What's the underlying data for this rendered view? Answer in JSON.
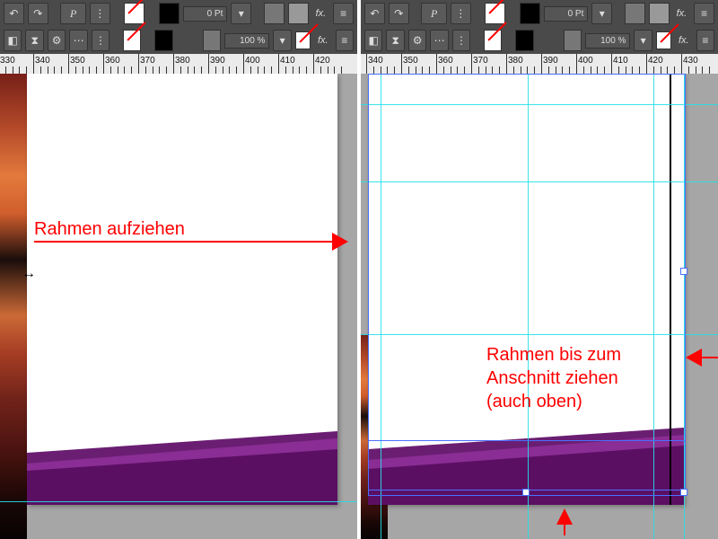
{
  "toolbar": {
    "history_icons": [
      "↶",
      "↷"
    ],
    "quickapply": "⚙",
    "char_style_letter": "P",
    "dotted": "⋯",
    "more": "⋮",
    "stroke_pt": "0 Pt",
    "opacity": "100 %",
    "fx": "fx.",
    "align": "≡"
  },
  "ruler_left": {
    "start": 330,
    "end": 425,
    "step": 10
  },
  "ruler_right": {
    "start": 430,
    "end": 430,
    "step": 10
  },
  "annotations": {
    "left": "Rahmen aufziehen",
    "right": "Rahmen bis zum\nAnschnitt ziehen\n(auch oben)"
  }
}
